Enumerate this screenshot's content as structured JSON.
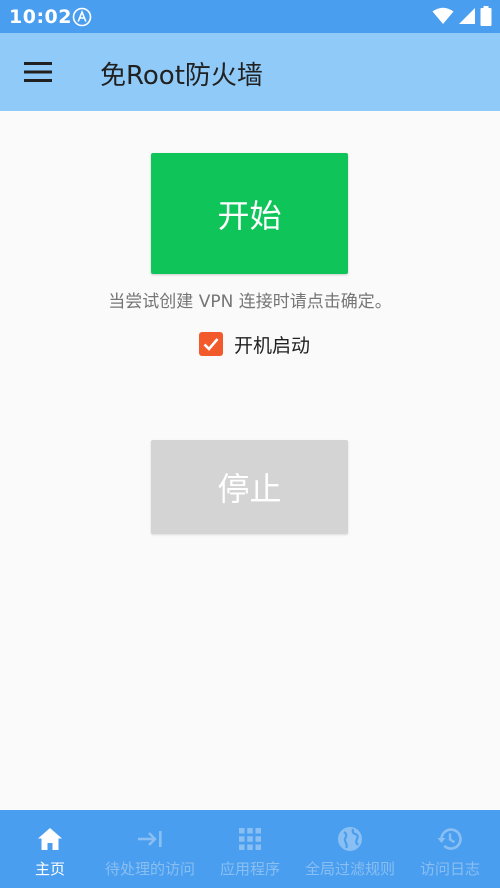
{
  "status_bar": {
    "time": "10:02"
  },
  "app_bar": {
    "title": "免Root防火墙"
  },
  "main": {
    "start_label": "开始",
    "hint": "当尝试创建 VPN 连接时请点击确定。",
    "autostart_label": "开机启动",
    "autostart_checked": true,
    "stop_label": "停止"
  },
  "bottom_nav": {
    "items": [
      {
        "label": "主页",
        "icon": "home-icon",
        "active": true
      },
      {
        "label": "待处理的访问",
        "icon": "arrow-to-bar-icon",
        "active": false
      },
      {
        "label": "应用程序",
        "icon": "apps-grid-icon",
        "active": false
      },
      {
        "label": "全局过滤规则",
        "icon": "globe-icon",
        "active": false
      },
      {
        "label": "访问日志",
        "icon": "history-icon",
        "active": false
      }
    ]
  },
  "colors": {
    "status_bar": "#4a9eef",
    "app_bar": "#90caf9",
    "start_button": "#0fc55a",
    "stop_button": "#d4d4d4",
    "checkbox": "#f2592b",
    "nav_active": "#ffffff",
    "nav_inactive": "#89bff2"
  }
}
